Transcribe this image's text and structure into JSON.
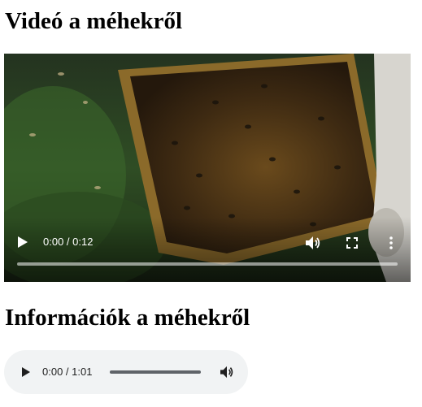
{
  "headings": {
    "video_section": "Videó a méhekről",
    "audio_section": "Információk a méhekről"
  },
  "video_player": {
    "time_display": "0:00 / 0:12",
    "progress": 0,
    "icons": [
      "play-icon",
      "volume-icon",
      "fullscreen-icon",
      "more-options-icon"
    ],
    "control_color": "#ffffff"
  },
  "audio_player": {
    "time_display": "0:00 / 1:01",
    "progress": 0,
    "icons": [
      "play-icon",
      "volume-icon"
    ],
    "background_color": "#f1f3f4"
  }
}
